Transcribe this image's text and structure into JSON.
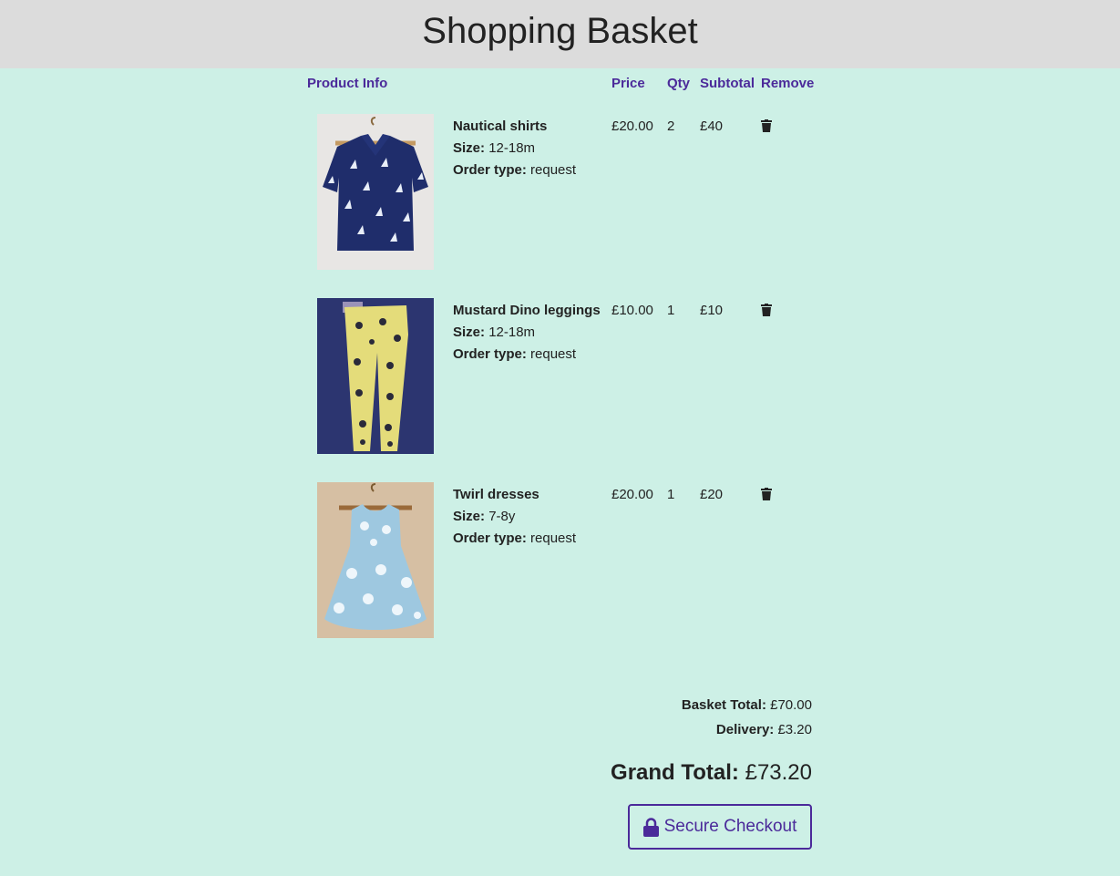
{
  "page": {
    "title": "Shopping Basket"
  },
  "table": {
    "headers": {
      "product_info": "Product Info",
      "price": "Price",
      "qty": "Qty",
      "subtotal": "Subtotal",
      "remove": "Remove"
    }
  },
  "labels": {
    "size": "Size:",
    "order_type": "Order type:"
  },
  "items": [
    {
      "name": "Nautical shirts",
      "size": "12-18m",
      "order_type": "request",
      "price": "£20.00",
      "qty": "2",
      "subtotal": "£40",
      "image": "navy-sailboat-shirt-photo"
    },
    {
      "name": "Mustard Dino leggings",
      "size": "12-18m",
      "order_type": "request",
      "price": "£10.00",
      "qty": "1",
      "subtotal": "£10",
      "image": "mustard-dino-leggings-photo"
    },
    {
      "name": "Twirl dresses",
      "size": "7-8y",
      "order_type": "request",
      "price": "£20.00",
      "qty": "1",
      "subtotal": "£20",
      "image": "blue-star-twirl-dress-photo"
    }
  ],
  "summary": {
    "basket_total_label": "Basket Total:",
    "basket_total": "£70.00",
    "delivery_label": "Delivery:",
    "delivery": "£3.20",
    "grand_total_label": "Grand Total:",
    "grand_total": "£73.20"
  },
  "checkout": {
    "label": "Secure Checkout",
    "icon": "lock-icon"
  },
  "colors": {
    "background": "#cdf0e6",
    "header_bg": "#dcdcdc",
    "accent": "#4b2a9a"
  }
}
